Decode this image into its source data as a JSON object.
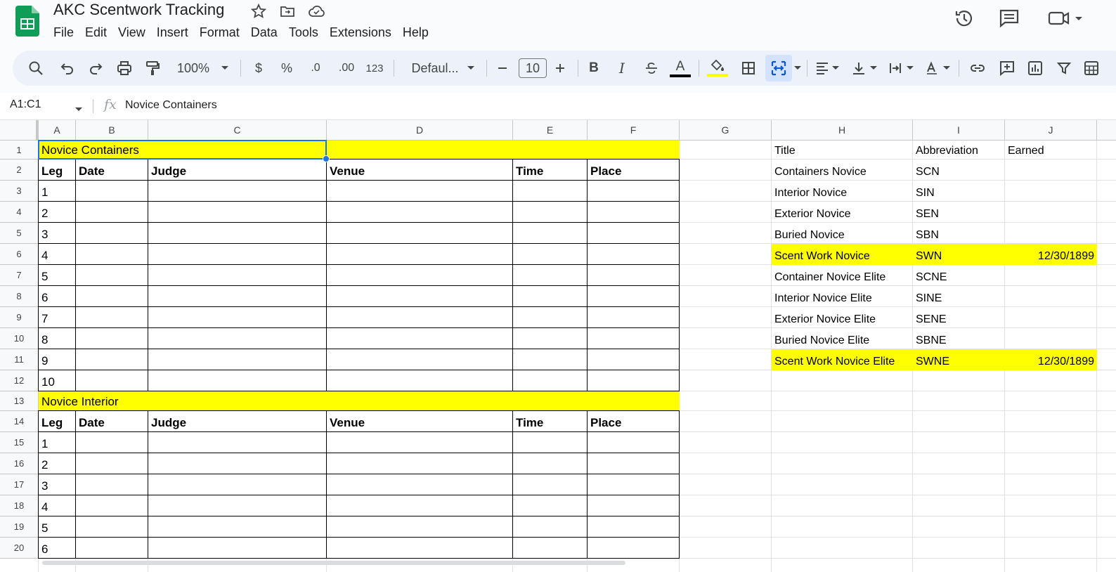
{
  "app": {
    "title": "AKC Scentwork Tracking",
    "menu": [
      "File",
      "Edit",
      "View",
      "Insert",
      "Format",
      "Data",
      "Tools",
      "Extensions",
      "Help"
    ],
    "brand_color": "#0f9d58"
  },
  "toolbar": {
    "zoom": "100%",
    "currency": "$",
    "percent": "%",
    "decrease_decimal": ".0",
    "increase_decimal": ".00",
    "number_format": "123",
    "font": "Defaul...",
    "font_size": "10",
    "bold": "B",
    "italic": "I",
    "text_color": "A",
    "text_color_value": "#000000",
    "fill_color_value": "#ffff00"
  },
  "formula_bar": {
    "name_box": "A1:C1",
    "fx": "fx",
    "content": "Novice Containers"
  },
  "columns": [
    "A",
    "B",
    "C",
    "D",
    "E",
    "F",
    "G",
    "H",
    "I",
    "J"
  ],
  "rows": [
    "1",
    "2",
    "3",
    "4",
    "5",
    "6",
    "7",
    "8",
    "9",
    "10",
    "11",
    "12",
    "13",
    "14",
    "15",
    "16",
    "17",
    "18",
    "19",
    "20"
  ],
  "sections": [
    {
      "title": "Novice Containers",
      "headers": [
        "Leg",
        "Date",
        "Judge",
        "Venue",
        "Time",
        "Place"
      ],
      "legs": [
        "1",
        "2",
        "3",
        "4",
        "5",
        "6",
        "7",
        "8",
        "9",
        "10"
      ]
    },
    {
      "title": "Novice Interior",
      "headers": [
        "Leg",
        "Date",
        "Judge",
        "Venue",
        "Time",
        "Place"
      ],
      "legs": [
        "1",
        "2",
        "3",
        "4",
        "5",
        "6"
      ]
    }
  ],
  "titles_table": {
    "headers": [
      "Title",
      "Abbreviation",
      "Earned"
    ],
    "rows": [
      {
        "title": "Containers Novice",
        "abbr": "SCN",
        "earned": "",
        "highlight": false
      },
      {
        "title": "Interior Novice",
        "abbr": "SIN",
        "earned": "",
        "highlight": false
      },
      {
        "title": "Exterior Novice",
        "abbr": "SEN",
        "earned": "",
        "highlight": false
      },
      {
        "title": "Buried Novice",
        "abbr": "SBN",
        "earned": "",
        "highlight": false
      },
      {
        "title": "Scent Work Novice",
        "abbr": "SWN",
        "earned": "12/30/1899",
        "highlight": true
      },
      {
        "title": "Container Novice Elite",
        "abbr": "SCNE",
        "earned": "",
        "highlight": false
      },
      {
        "title": "Interior Novice Elite",
        "abbr": "SINE",
        "earned": "",
        "highlight": false
      },
      {
        "title": "Exterior Novice Elite",
        "abbr": "SENE",
        "earned": "",
        "highlight": false
      },
      {
        "title": "Buried Novice Elite",
        "abbr": "SBNE",
        "earned": "",
        "highlight": false
      },
      {
        "title": "Scent Work Novice Elite",
        "abbr": "SWNE",
        "earned": "12/30/1899",
        "highlight": true
      }
    ]
  },
  "colors": {
    "highlight": "#ffff00",
    "selection": "#1a73e8"
  }
}
